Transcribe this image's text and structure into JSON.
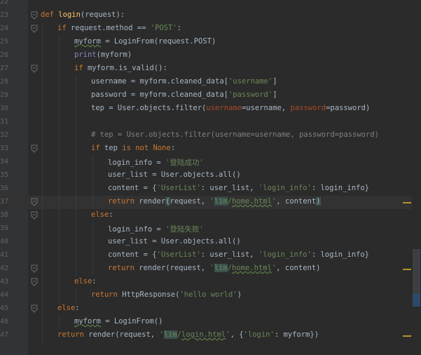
{
  "lines": [
    {
      "n": "22",
      "indent": 0,
      "tokens": []
    },
    {
      "n": "23",
      "indent": 0,
      "tokens": [
        [
          "def",
          "kw"
        ],
        [
          " ",
          "plain"
        ],
        [
          "login",
          "fn"
        ],
        [
          "(request):",
          "plain"
        ]
      ]
    },
    {
      "n": "24",
      "indent": 1,
      "tokens": [
        [
          "if",
          "kw"
        ],
        [
          " request.method == ",
          "plain"
        ],
        [
          "'POST'",
          "str"
        ],
        [
          ":",
          "plain"
        ]
      ]
    },
    {
      "n": "25",
      "indent": 2,
      "tokens": [
        [
          "myform",
          "plain underline"
        ],
        [
          " = LoginFrom(request.POST)",
          "plain"
        ]
      ]
    },
    {
      "n": "26",
      "indent": 2,
      "tokens": [
        [
          "print",
          "builtin"
        ],
        [
          "(myform)",
          "plain"
        ]
      ]
    },
    {
      "n": "27",
      "indent": 2,
      "tokens": [
        [
          "if",
          "kw"
        ],
        [
          " myform.is_valid():",
          "plain"
        ]
      ]
    },
    {
      "n": "28",
      "indent": 3,
      "tokens": [
        [
          "username = myform.cleaned_data[",
          "plain"
        ],
        [
          "'username'",
          "str"
        ],
        [
          "]",
          "plain"
        ]
      ]
    },
    {
      "n": "29",
      "indent": 3,
      "tokens": [
        [
          "password = myform.cleaned_data[",
          "plain"
        ],
        [
          "'password'",
          "str"
        ],
        [
          "]",
          "plain"
        ]
      ]
    },
    {
      "n": "30",
      "indent": 3,
      "tokens": [
        [
          "tep = User.objects.filter(",
          "plain"
        ],
        [
          "username",
          "param"
        ],
        [
          "=username, ",
          "plain"
        ],
        [
          "password",
          "param"
        ],
        [
          "=password)",
          "plain"
        ]
      ]
    },
    {
      "n": "31",
      "indent": 3,
      "tokens": []
    },
    {
      "n": "32",
      "indent": 3,
      "tokens": [
        [
          "# tep = User.objects.filter(username=username, password=password)",
          "cmt"
        ]
      ]
    },
    {
      "n": "33",
      "indent": 3,
      "tokens": [
        [
          "if",
          "kw"
        ],
        [
          " tep ",
          "plain"
        ],
        [
          "is not None",
          "kw"
        ],
        [
          ":",
          "plain"
        ]
      ]
    },
    {
      "n": "34",
      "indent": 4,
      "tokens": [
        [
          "login_info = ",
          "plain"
        ],
        [
          "'登陆成功'",
          "str"
        ]
      ]
    },
    {
      "n": "35",
      "indent": 4,
      "tokens": [
        [
          "user_list = User.objects.all()",
          "plain"
        ]
      ]
    },
    {
      "n": "36",
      "indent": 4,
      "tokens": [
        [
          "content = {",
          "plain"
        ],
        [
          "'UserList'",
          "str"
        ],
        [
          ": user_list, ",
          "plain"
        ],
        [
          "'login_info'",
          "str"
        ],
        [
          ": login_info}",
          "plain"
        ]
      ]
    },
    {
      "n": "37",
      "indent": 4,
      "current": true,
      "tokens": [
        [
          "return",
          "kw"
        ],
        [
          " render",
          "plain"
        ],
        [
          "(",
          "plain brace-hl"
        ],
        [
          "request, ",
          "plain"
        ],
        [
          "'",
          "str"
        ],
        [
          "lim",
          "str hl"
        ],
        [
          "/",
          "str"
        ],
        [
          "home.html",
          "str underline"
        ],
        [
          "'",
          "str"
        ],
        [
          ", content",
          "plain"
        ],
        [
          ")",
          "plain brace-hl"
        ]
      ]
    },
    {
      "n": "38",
      "indent": 3,
      "tokens": [
        [
          "else",
          "kw"
        ],
        [
          ":",
          "plain"
        ]
      ]
    },
    {
      "n": "39",
      "indent": 4,
      "tokens": [
        [
          "login_info = ",
          "plain"
        ],
        [
          "'登陆失败'",
          "str"
        ]
      ]
    },
    {
      "n": "40",
      "indent": 4,
      "tokens": [
        [
          "user_list = User.objects.all()",
          "plain"
        ]
      ]
    },
    {
      "n": "41",
      "indent": 4,
      "tokens": [
        [
          "content = {",
          "plain"
        ],
        [
          "'UserList'",
          "str"
        ],
        [
          ": user_list, ",
          "plain"
        ],
        [
          "'login_info'",
          "str"
        ],
        [
          ": login_info}",
          "plain"
        ]
      ]
    },
    {
      "n": "42",
      "indent": 4,
      "tokens": [
        [
          "return",
          "kw"
        ],
        [
          " render(request, ",
          "plain"
        ],
        [
          "'",
          "str"
        ],
        [
          "lim",
          "str hl"
        ],
        [
          "/",
          "str"
        ],
        [
          "home.html",
          "str underline"
        ],
        [
          "'",
          "str"
        ],
        [
          ", content)",
          "plain"
        ]
      ]
    },
    {
      "n": "43",
      "indent": 2,
      "tokens": [
        [
          "else",
          "kw"
        ],
        [
          ":",
          "plain"
        ]
      ]
    },
    {
      "n": "44",
      "indent": 3,
      "tokens": [
        [
          "return",
          "kw"
        ],
        [
          " HttpResponse(",
          "plain"
        ],
        [
          "'hello world'",
          "str"
        ],
        [
          ")",
          "plain"
        ]
      ]
    },
    {
      "n": "45",
      "indent": 1,
      "tokens": [
        [
          "else",
          "kw"
        ],
        [
          ":",
          "plain"
        ]
      ]
    },
    {
      "n": "46",
      "indent": 2,
      "tokens": [
        [
          "myform",
          "plain underline"
        ],
        [
          " = LoginFrom()",
          "plain"
        ]
      ]
    },
    {
      "n": "47",
      "indent": 1,
      "tokens": [
        [
          "return",
          "kw"
        ],
        [
          " render(request, ",
          "plain"
        ],
        [
          "'",
          "str"
        ],
        [
          "lim",
          "str hl"
        ],
        [
          "/",
          "str"
        ],
        [
          "login.html",
          "str underline"
        ],
        [
          "'",
          "str"
        ],
        [
          ", {",
          "plain"
        ],
        [
          "'login'",
          "str"
        ],
        [
          ": myform})",
          "plain"
        ]
      ]
    }
  ],
  "fold_lines": [
    "23",
    "24",
    "27",
    "33",
    "37",
    "38",
    "42",
    "43",
    "45"
  ],
  "marker_lines": [
    "37",
    "42",
    "47"
  ],
  "colors": {
    "background": "#2b2b2b",
    "gutter": "#313335",
    "keyword": "#cc7832",
    "string": "#6a8759",
    "comment": "#808080",
    "builtin": "#8888c6",
    "param": "#aa4926",
    "function": "#ffc66d",
    "text": "#a9b7c6"
  }
}
